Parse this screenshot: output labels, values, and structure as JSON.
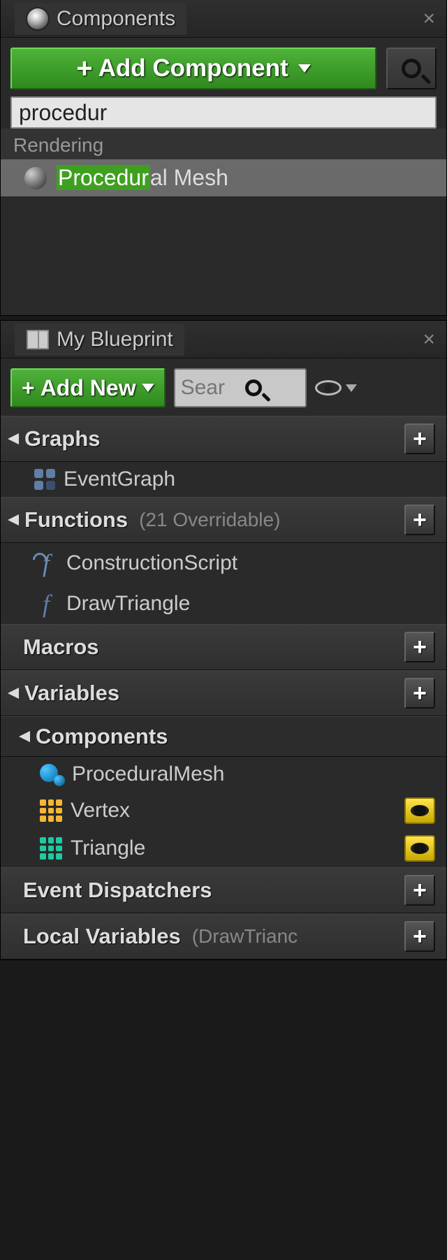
{
  "components_panel": {
    "tab_title": "Components",
    "add_button": "Add Component",
    "search_value": "procedur",
    "category": "Rendering",
    "result_prefix_hl": "Procedur",
    "result_suffix": "al Mesh"
  },
  "blueprint_panel": {
    "tab_title": "My Blueprint",
    "add_new": "Add New",
    "search_placeholder": "Sear",
    "sections": {
      "graphs": {
        "title": "Graphs",
        "items": [
          "EventGraph"
        ]
      },
      "functions": {
        "title": "Functions",
        "subtitle": "(21 Overridable)",
        "items": [
          "ConstructionScript",
          "DrawTriangle"
        ]
      },
      "macros": {
        "title": "Macros"
      },
      "variables": {
        "title": "Variables"
      },
      "components_sub": {
        "title": "Components",
        "items": [
          {
            "name": "ProceduralMesh",
            "icon": "blue-blob",
            "eye": false
          },
          {
            "name": "Vertex",
            "icon": "grid-yellow",
            "eye": true
          },
          {
            "name": "Triangle",
            "icon": "grid-teal",
            "eye": true
          }
        ]
      },
      "event_dispatchers": {
        "title": "Event Dispatchers"
      },
      "local_variables": {
        "title": "Local Variables",
        "subtitle": "(DrawTrianc"
      }
    }
  }
}
